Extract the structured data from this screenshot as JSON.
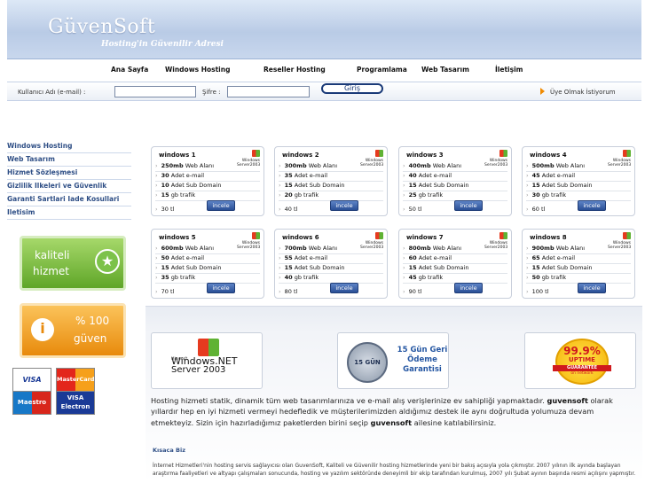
{
  "header": {
    "logo": "GüvenSoft",
    "tagline": "Hosting'in Güvenilir Adresi"
  },
  "nav": [
    "Ana Sayfa",
    "Windows Hosting",
    "Reseller Hosting",
    "Programlama",
    "Web Tasarım",
    "İletişim"
  ],
  "login": {
    "username_label": "Kullanıcı Adı (e-mail) :",
    "username_value": "",
    "password_label": "Şifre :",
    "password_value": "",
    "submit_label": "Giriş",
    "register_label": "Üye Olmak İstiyorum"
  },
  "sidebar": {
    "items": [
      "Windows Hosting",
      "Web Tasarım",
      "Hizmet Sözleşmesi",
      "Gizlilik Ilkeleri ve Güvenlik",
      "Garanti Sartlari Iade Kosullari",
      "Iletisim"
    ],
    "badge_quality": [
      "kaliteli",
      "hizmet"
    ],
    "badge_trust": [
      "% 100",
      "güven"
    ],
    "cards": {
      "visa": "VISA",
      "mastercard": "MasterCard",
      "maestro": "Maestro",
      "electron_top": "VISA",
      "electron_bottom": "Electron"
    }
  },
  "packages_common": {
    "logo_line1": "Windows",
    "logo_line2": "Server2003",
    "labels": [
      "Web Alanı",
      "Adet e-mail",
      "Adet Sub Domain",
      "gb trafik"
    ],
    "buy_label": "incele"
  },
  "packages": [
    {
      "name": "windows 1",
      "space": "250mb",
      "email": "30",
      "sub": "10",
      "traffic": "15",
      "price": "30 tl"
    },
    {
      "name": "windows 2",
      "space": "300mb",
      "email": "35",
      "sub": "15",
      "traffic": "20",
      "price": "40 tl"
    },
    {
      "name": "windows 3",
      "space": "400mb",
      "email": "40",
      "sub": "15",
      "traffic": "25",
      "price": "50 tl"
    },
    {
      "name": "windows 4",
      "space": "500mb",
      "email": "45",
      "sub": "15",
      "traffic": "30",
      "price": "60 tl"
    },
    {
      "name": "windows 5",
      "space": "600mb",
      "email": "50",
      "sub": "15",
      "traffic": "35",
      "price": "70 tl"
    },
    {
      "name": "windows 6",
      "space": "700mb",
      "email": "55",
      "sub": "15",
      "traffic": "40",
      "price": "80 tl"
    },
    {
      "name": "windows 7",
      "space": "800mb",
      "email": "60",
      "sub": "15",
      "traffic": "45",
      "price": "90 tl"
    },
    {
      "name": "windows 8",
      "space": "900mb",
      "email": "65",
      "sub": "15",
      "traffic": "50",
      "price": "100 tl"
    }
  ],
  "promos": {
    "winnet_ms": "Microsoft",
    "winnet_line1": "Windows.NET",
    "winnet_line2": "Server 2003",
    "guarantee_seal": "15 GÜN",
    "guarantee_line1": "15 Gün Geri",
    "guarantee_line2": "Ödeme",
    "guarantee_line3": "Garantisi",
    "uptime_big": "99.9%",
    "uptime_mid": "UPTIME",
    "uptime_ribbon": "GUARANTEE",
    "uptime_net": "on network"
  },
  "intro": {
    "part1": "Hosting hizmeti statik, dinamik tüm web tasarımlarınıza ve e-mail alış verişlerinize ev sahipliği yapmaktadır.",
    "brand1": "guvensoft",
    "part2": "olarak yıllardır hep en iyi hizmeti vermeyi hedefledik ve müşterilerimizden aldığımız destek ile aynı doğrultuda yolumuza devam etmekteyiz. Sizin için hazırladığımız paketlerden birini seçip",
    "brand2": "guvensoft",
    "part3": "ailesine katılabilirsiniz."
  },
  "about": {
    "title": "Kısaca Biz",
    "text": "İnternet Hizmetleri'nin hosting servis sağlayıcısı olan GuvenSoft, Kaliteli ve Güvenilir hosting hizmetlerinde yeni bir bakış açısıyla yola çıkmıştır. 2007 yılının ilk ayında başlayan araştırma faaliyetleri ve altyapı çalışmaları sonucunda, hosting ve yazılım sektöründe deneyimli bir ekip tarafından kurulmuş, 2007 yılı Şubat ayının başında resmi açılışını yapmıştır."
  }
}
